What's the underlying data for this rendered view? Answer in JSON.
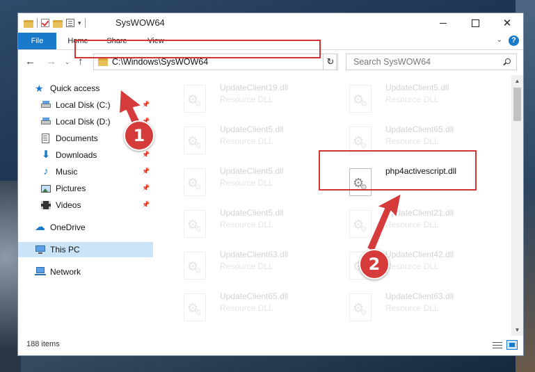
{
  "window": {
    "title": "SysWOW64",
    "controls": {
      "minimize": "minimize",
      "maximize": "maximize",
      "close": "✕"
    }
  },
  "ribbon": {
    "tabs": [
      {
        "label": "File"
      },
      {
        "label": "Home"
      },
      {
        "label": "Share"
      },
      {
        "label": "View"
      }
    ],
    "help_label": "?"
  },
  "navbar": {
    "back": "←",
    "forward": "→",
    "recent": "⌄",
    "up": "↑",
    "address": "C:\\Windows\\SysWOW64",
    "refresh": "↻",
    "search_placeholder": "Search SysWOW64"
  },
  "navpane": {
    "items": [
      {
        "label": "Quick access",
        "icon": "star-icon"
      },
      {
        "label": "Local Disk (C:)",
        "icon": "drive-icon",
        "pinned": true
      },
      {
        "label": "Local Disk (D:)",
        "icon": "drive-icon",
        "pinned": true
      },
      {
        "label": "Documents",
        "icon": "documents-icon",
        "pinned": true
      },
      {
        "label": "Downloads",
        "icon": "download-icon",
        "pinned": true
      },
      {
        "label": "Music",
        "icon": "music-icon",
        "pinned": true
      },
      {
        "label": "Pictures",
        "icon": "pictures-icon",
        "pinned": true
      },
      {
        "label": "Videos",
        "icon": "videos-icon",
        "pinned": true
      },
      {
        "label": "OneDrive",
        "icon": "cloud-icon"
      },
      {
        "label": "This PC",
        "icon": "computer-icon",
        "selected": true
      },
      {
        "label": "Network",
        "icon": "network-icon"
      }
    ]
  },
  "files": {
    "left": [
      {
        "name": "UpdateClient19.dll",
        "type": "Resource DLL"
      },
      {
        "name": "UpdateClient5.dll",
        "type": "Resource DLL"
      },
      {
        "name": "UpdateClient5.dll",
        "type": "Resource DLL"
      },
      {
        "name": "UpdateClient5.dll",
        "type": "Resource DLL"
      },
      {
        "name": "UpdateClient63.dll",
        "type": "Resource DLL"
      },
      {
        "name": "UpdateClient65.dll",
        "type": "Resource DLL"
      }
    ],
    "right": [
      {
        "name": "UpdateClient5.dll",
        "type": "Resource DLL"
      },
      {
        "name": "UpdateClient65.dll",
        "type": "Resource DLL"
      },
      {
        "name": "php4activescript.dll",
        "type": "",
        "highlight": true
      },
      {
        "name": "UpdateClient21.dll",
        "type": "Resource DLL"
      },
      {
        "name": "UpdateClient42.dll",
        "type": "Resource DLL"
      },
      {
        "name": "UpdateClient63.dll",
        "type": "Resource DLL"
      }
    ]
  },
  "status": {
    "item_count": "188 items"
  },
  "annotations": {
    "step1": "1",
    "step2": "2",
    "color": "#d63b3b"
  }
}
